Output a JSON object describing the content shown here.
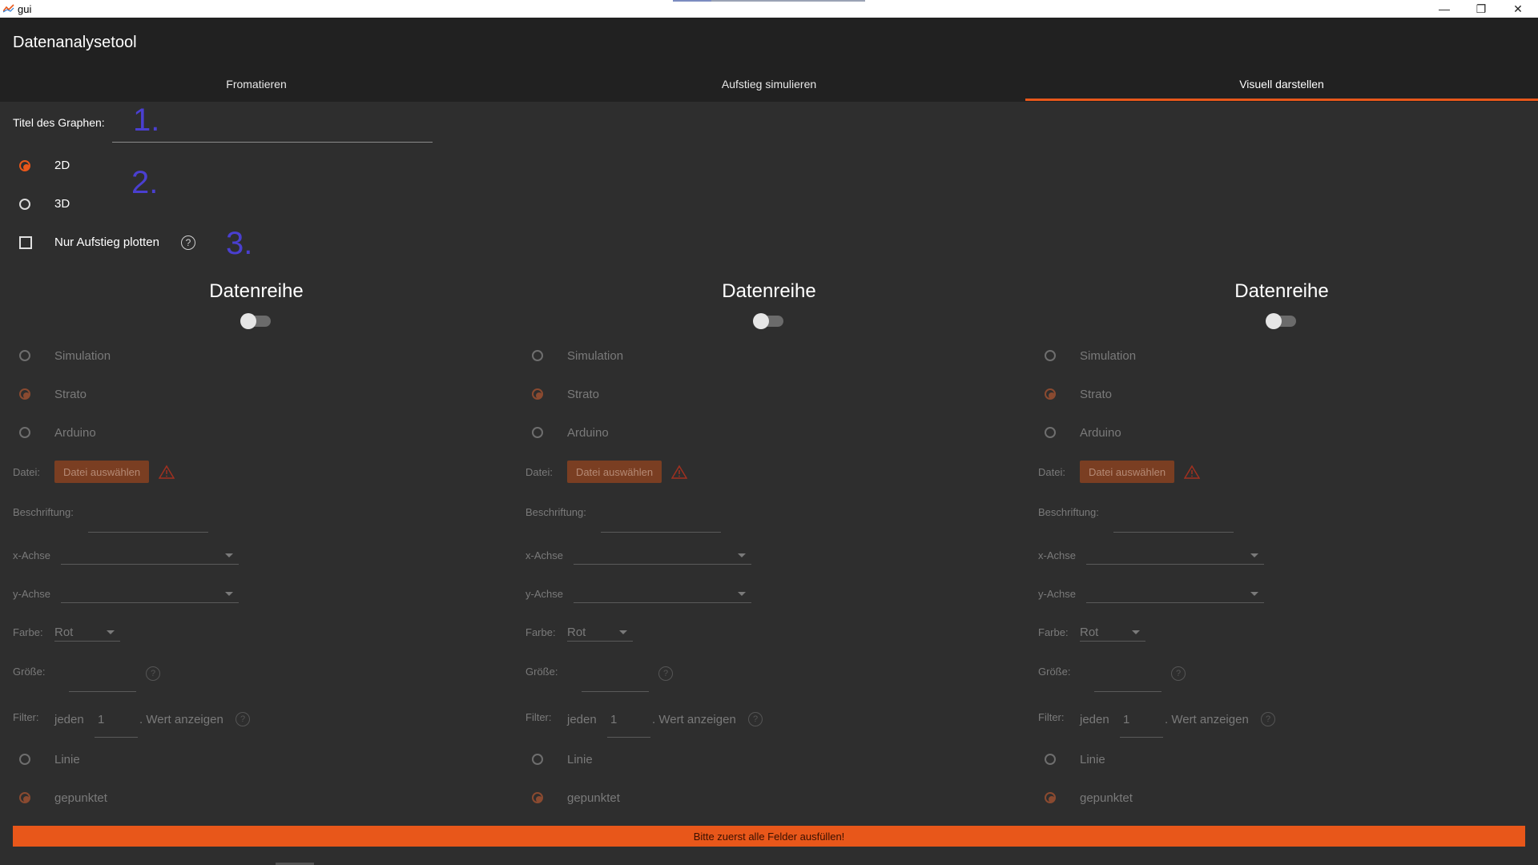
{
  "window": {
    "title": "gui",
    "minimize": "—",
    "restore": "❐",
    "close": "✕"
  },
  "app": {
    "title": "Datenanalysetool"
  },
  "tabs": [
    {
      "label": "Fromatieren",
      "active": false
    },
    {
      "label": "Aufstieg simulieren",
      "active": false
    },
    {
      "label": "Visuell darstellen",
      "active": true
    }
  ],
  "form": {
    "graph_title_label": "Titel des Graphen:",
    "graph_title_value": "",
    "dim_2d": "2D",
    "dim_3d": "3D",
    "selected_dim": "2D",
    "only_ascent_label": "Nur Aufstieg plotten",
    "only_ascent_checked": false,
    "help_glyph": "?"
  },
  "annotations": [
    "1.",
    "2.",
    "3."
  ],
  "series_columns": [
    {
      "title": "Datenreihe",
      "enabled": false,
      "sources": [
        "Simulation",
        "Strato",
        "Arduino"
      ],
      "selected_source": "Strato",
      "file_label": "Datei:",
      "file_button": "Datei auswählen",
      "caption_label": "Beschriftung:",
      "x_label": "x-Achse",
      "y_label": "y-Achse",
      "color_label": "Farbe:",
      "color_value": "Rot",
      "size_label": "Größe:",
      "filter_label": "Filter:",
      "filter_prefix": "jeden",
      "filter_value": "1",
      "filter_suffix": ". Wert anzeigen",
      "styles": [
        "Linie",
        "gepunktet"
      ],
      "selected_style": "gepunktet"
    },
    {
      "title": "Datenreihe",
      "enabled": false,
      "sources": [
        "Simulation",
        "Strato",
        "Arduino"
      ],
      "selected_source": "Strato",
      "file_label": "Datei:",
      "file_button": "Datei auswählen",
      "caption_label": "Beschriftung:",
      "x_label": "x-Achse",
      "y_label": "y-Achse",
      "color_label": "Farbe:",
      "color_value": "Rot",
      "size_label": "Größe:",
      "filter_label": "Filter:",
      "filter_prefix": "jeden",
      "filter_value": "1",
      "filter_suffix": ". Wert anzeigen",
      "styles": [
        "Linie",
        "gepunktet"
      ],
      "selected_style": "gepunktet"
    },
    {
      "title": "Datenreihe",
      "enabled": false,
      "sources": [
        "Simulation",
        "Strato",
        "Arduino"
      ],
      "selected_source": "Strato",
      "file_label": "Datei:",
      "file_button": "Datei auswählen",
      "caption_label": "Beschriftung:",
      "x_label": "x-Achse",
      "y_label": "y-Achse",
      "color_label": "Farbe:",
      "color_value": "Rot",
      "size_label": "Größe:",
      "filter_label": "Filter:",
      "filter_prefix": "jeden",
      "filter_value": "1",
      "filter_suffix": ". Wert anzeigen",
      "styles": [
        "Linie",
        "gepunktet"
      ],
      "selected_style": "gepunktet"
    }
  ],
  "submit": {
    "label": "Bitte zuerst alle Felder ausfüllen!"
  },
  "colors": {
    "accent": "#e8571a",
    "background": "#2e2e2e",
    "header": "#212121",
    "annotation": "#4a3fd0"
  },
  "icons": {
    "app": "chart-line-icon",
    "help": "question-circle-icon",
    "warning": "warning-triangle-icon",
    "dropdown": "chevron-down-icon"
  }
}
